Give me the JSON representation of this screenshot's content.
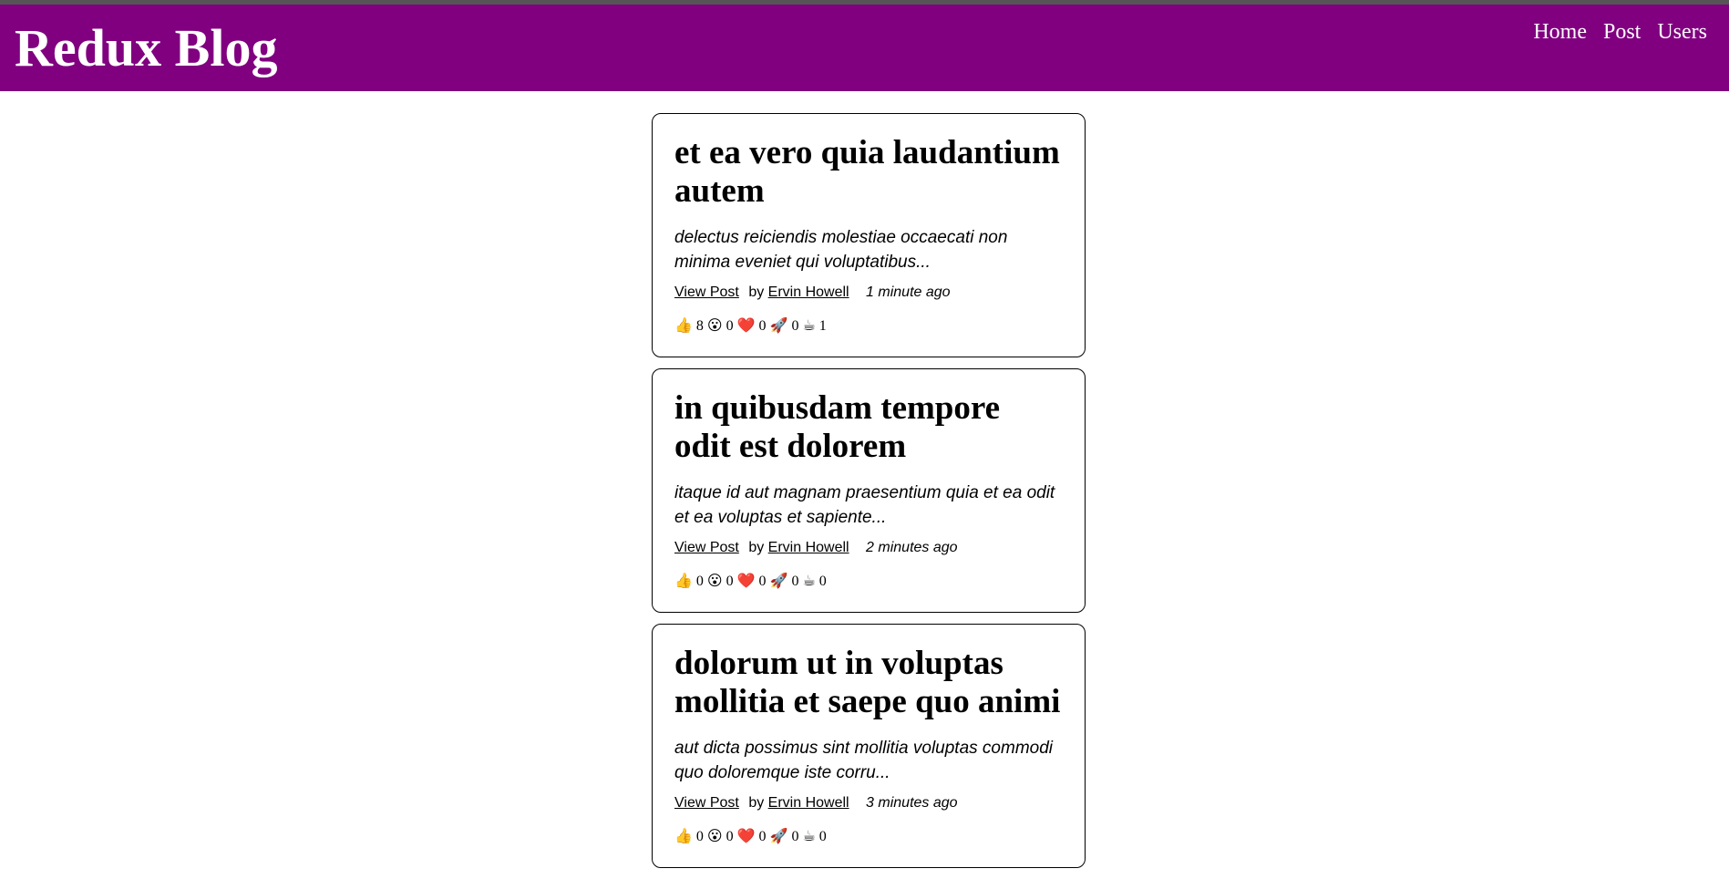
{
  "header": {
    "title": "Redux Blog",
    "nav": [
      "Home",
      "Post",
      "Users"
    ],
    "color": "#800080"
  },
  "posts": [
    {
      "title": "et ea vero quia laudantium autem",
      "excerpt": "delectus reiciendis molestiae occaecati non minima eveniet qui voluptatibus...",
      "view_label": "View Post",
      "by_label": "by",
      "author": "Ervin Howell",
      "time": "1 minute ago",
      "reactions": [
        {
          "emoji": "👍",
          "count": "8"
        },
        {
          "emoji": "😮",
          "count": "0"
        },
        {
          "emoji": "❤️",
          "count": "0"
        },
        {
          "emoji": "🚀",
          "count": "0"
        },
        {
          "emoji": "☕",
          "count": "1"
        }
      ]
    },
    {
      "title": "in quibusdam tempore odit est dolorem",
      "excerpt": "itaque id aut magnam praesentium quia et ea odit et ea voluptas et sapiente...",
      "view_label": "View Post",
      "by_label": "by",
      "author": "Ervin Howell",
      "time": "2 minutes ago",
      "reactions": [
        {
          "emoji": "👍",
          "count": "0"
        },
        {
          "emoji": "😮",
          "count": "0"
        },
        {
          "emoji": "❤️",
          "count": "0"
        },
        {
          "emoji": "🚀",
          "count": "0"
        },
        {
          "emoji": "☕",
          "count": "0"
        }
      ]
    },
    {
      "title": "dolorum ut in voluptas mollitia et saepe quo animi",
      "excerpt": "aut dicta possimus sint mollitia voluptas commodi quo doloremque iste corru...",
      "view_label": "View Post",
      "by_label": "by",
      "author": "Ervin Howell",
      "time": "3 minutes ago",
      "reactions": [
        {
          "emoji": "👍",
          "count": "0"
        },
        {
          "emoji": "😮",
          "count": "0"
        },
        {
          "emoji": "❤️",
          "count": "0"
        },
        {
          "emoji": "🚀",
          "count": "0"
        },
        {
          "emoji": "☕",
          "count": "0"
        }
      ]
    }
  ],
  "reaction_icons": [
    "thumbs-up-icon",
    "wow-icon",
    "heart-icon",
    "rocket-icon",
    "coffee-icon"
  ]
}
